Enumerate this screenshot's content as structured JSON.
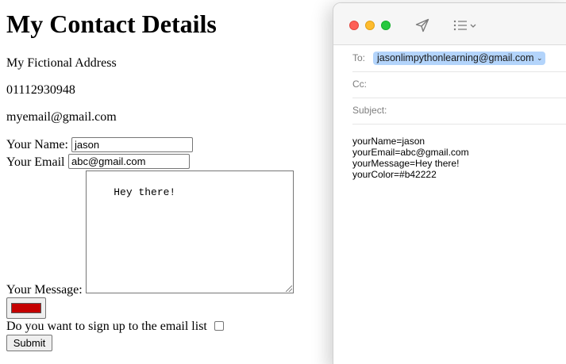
{
  "page": {
    "title": "My Contact Details",
    "address": "My Fictional Address",
    "phone": "01112930948",
    "email": "myemail@gmail.com"
  },
  "form": {
    "name_label": "Your Name:",
    "name_value": "jason",
    "email_label": "Your Email",
    "email_value": "abc@gmail.com",
    "message_label": "Your Message:",
    "message_value": "Hey there!",
    "color_value": "#b42222",
    "color_swatch_display": "#c40000",
    "signup_label": "Do you want to sign up to the email list",
    "signup_checked": false,
    "submit_label": "Submit"
  },
  "mail": {
    "toolbar": {
      "send_icon": "paper-plane-icon",
      "format_icon": "list-chevron-icon"
    },
    "to_label": "To:",
    "to_recipient": "jasonlimpythonlearning@gmail.com",
    "cc_label": "Cc:",
    "subject_label": "Subject:",
    "body_lines": [
      "yourName=jason",
      "yourEmail=abc@gmail.com",
      "yourMessage=Hey there!",
      "yourColor=#b42222"
    ]
  },
  "colors": {
    "traffic_red": "#fe5f57",
    "traffic_yellow": "#febc2e",
    "traffic_green": "#28c840",
    "recipient_chip": "#b3d4fb"
  }
}
